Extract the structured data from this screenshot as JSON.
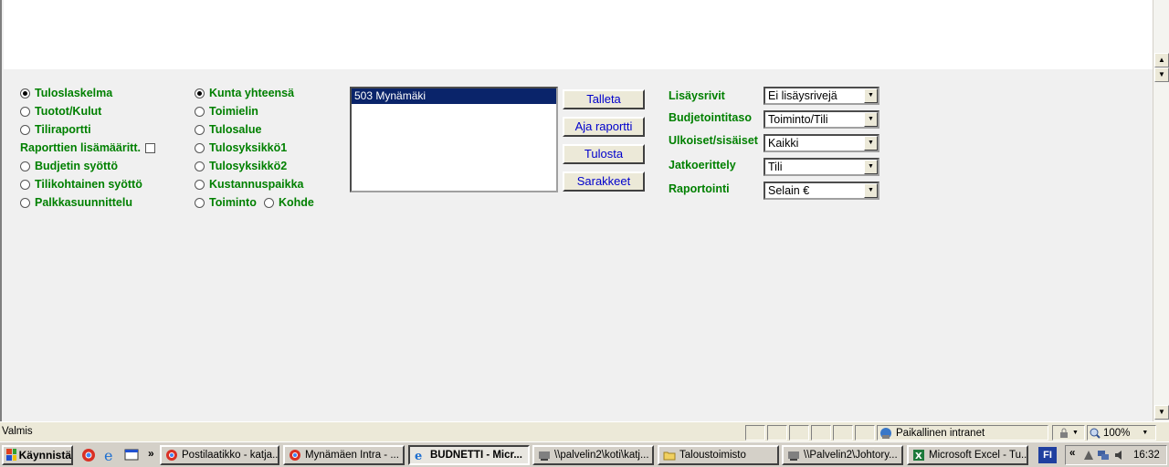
{
  "report_types": [
    {
      "label": "Tuloslaskelma",
      "selected": true
    },
    {
      "label": "Tuotot/Kulut",
      "selected": false
    },
    {
      "label": "Tiliraportti",
      "selected": false
    }
  ],
  "extra_definitions_label": "Raporttien lisämääritt.",
  "report_types_2": [
    {
      "label": "Budjetin syöttö",
      "selected": false
    },
    {
      "label": "Tilikohtainen syöttö",
      "selected": false
    },
    {
      "label": "Palkkasuunnittelu",
      "selected": false
    }
  ],
  "levels": [
    {
      "label": "Kunta yhteensä",
      "selected": true
    },
    {
      "label": "Toimielin",
      "selected": false
    },
    {
      "label": "Tulosalue",
      "selected": false
    },
    {
      "label": "Tulosyksikkö1",
      "selected": false
    },
    {
      "label": "Tulosyksikkö2",
      "selected": false
    },
    {
      "label": "Kustannuspaikka",
      "selected": false
    }
  ],
  "level_last": {
    "a": "Toiminto",
    "b": "Kohde"
  },
  "listbox": {
    "selected_item": "503 Mynämäki"
  },
  "buttons": {
    "save": "Talleta",
    "run": "Aja raportti",
    "print": "Tulosta",
    "columns": "Sarakkeet"
  },
  "fields": [
    {
      "label": "Lisäysrivit",
      "value": "Ei lisäysrivejä"
    },
    {
      "label": "Budjetointitaso",
      "value": "Toiminto/Tili"
    },
    {
      "label": "Ulkoiset/sisäiset",
      "value": "Kaikki"
    },
    {
      "label": "Jatkoerittely",
      "value": "Tili"
    },
    {
      "label": "Raportointi",
      "value": "Selain €"
    }
  ],
  "status": {
    "text": "Valmis",
    "zone": "Paikallinen intranet",
    "zoom": "100%"
  },
  "taskbar": {
    "start": "Käynnistä",
    "tasks": [
      "Postilaatikko - katja...",
      "Mynämäen Intra - ...",
      "BUDNETTI - Micr...",
      "\\\\palvelin2\\koti\\katj...",
      "Taloustoimisto",
      "\\\\Palvelin2\\Johtory...",
      "Microsoft Excel - Tu..."
    ],
    "lang": "FI",
    "clock": "16:32"
  },
  "colors": {
    "label_green": "#008000",
    "selection_blue": "#0a246a",
    "button_text": "#0000cc"
  }
}
